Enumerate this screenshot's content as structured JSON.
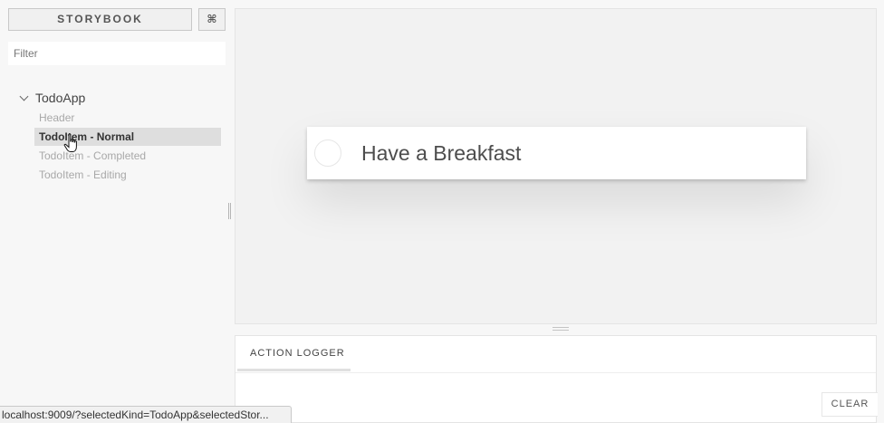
{
  "sidebar": {
    "brand": "STORYBOOK",
    "shortcut_symbol": "⌘",
    "filter_placeholder": "Filter",
    "kind": {
      "label": "TodoApp",
      "expanded": true,
      "stories": [
        {
          "label": "Header",
          "selected": false
        },
        {
          "label": "TodoItem - Normal",
          "selected": true
        },
        {
          "label": "TodoItem - Completed",
          "selected": false
        },
        {
          "label": "TodoItem - Editing",
          "selected": false
        }
      ]
    }
  },
  "preview": {
    "todo_text": "Have a Breakfast",
    "completed": false
  },
  "panel": {
    "tab_label": "ACTION LOGGER",
    "clear_label": "CLEAR"
  },
  "status_bar": {
    "url": "localhost:9009/?selectedKind=TodoApp&selectedStor..."
  },
  "icons": {
    "chevron": "chevron-down-icon",
    "cursor": "hand-pointer-icon",
    "shortcut": "command-icon"
  },
  "colors": {
    "selected_bg": "#dedede",
    "muted_text": "#a8a8a8",
    "preview_bg": "#f2f2f2"
  }
}
